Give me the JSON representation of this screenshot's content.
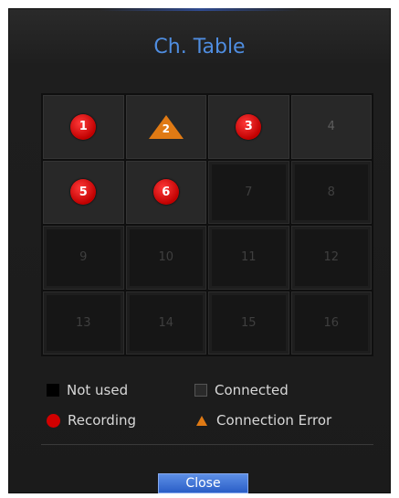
{
  "dialog": {
    "title": "Ch. Table",
    "close_label": "Close"
  },
  "channels": [
    {
      "label": "1",
      "status": "recording"
    },
    {
      "label": "2",
      "status": "connection-error"
    },
    {
      "label": "3",
      "status": "recording"
    },
    {
      "label": "4",
      "status": "connected"
    },
    {
      "label": "5",
      "status": "recording"
    },
    {
      "label": "6",
      "status": "recording"
    },
    {
      "label": "7",
      "status": "not-used"
    },
    {
      "label": "8",
      "status": "not-used"
    },
    {
      "label": "9",
      "status": "not-used"
    },
    {
      "label": "10",
      "status": "not-used"
    },
    {
      "label": "11",
      "status": "not-used"
    },
    {
      "label": "12",
      "status": "not-used"
    },
    {
      "label": "13",
      "status": "not-used"
    },
    {
      "label": "14",
      "status": "not-used"
    },
    {
      "label": "15",
      "status": "not-used"
    },
    {
      "label": "16",
      "status": "not-used"
    }
  ],
  "legend": {
    "not_used": "Not used",
    "connected": "Connected",
    "recording": "Recording",
    "connection_error": "Connection Error"
  },
  "colors": {
    "title": "#4f8de0",
    "recording": "#d10000",
    "connection_error": "#e07a14",
    "button": "#3a6fd8"
  }
}
